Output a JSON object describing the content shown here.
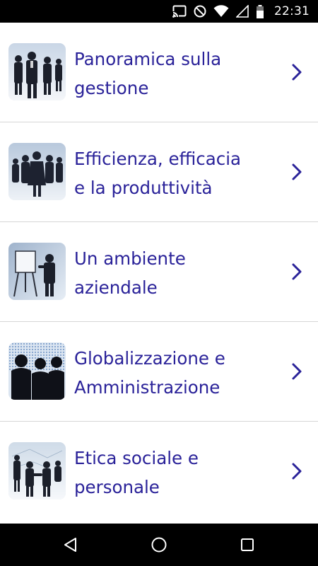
{
  "status_bar": {
    "time": "22:31",
    "icons": [
      "cast-icon",
      "do-not-disturb-icon",
      "wifi-icon",
      "signal-icon",
      "battery-icon"
    ]
  },
  "list": {
    "items": [
      {
        "label": "Panoramica sulla\ngestione",
        "thumb_icon": "business-team-image"
      },
      {
        "label": "Efficienza, efficacia\ne la produttività",
        "thumb_icon": "business-team-image"
      },
      {
        "label": "Un ambiente\naziendale",
        "thumb_icon": "presentation-flipchart-image"
      },
      {
        "label": "Globalizzazione e\nAmministrazione",
        "thumb_icon": "business-silhouettes-image"
      },
      {
        "label": "Etica sociale e\npersonale",
        "thumb_icon": "handshake-image"
      }
    ],
    "chevron_icon": "chevron-right-icon"
  },
  "nav_bar": {
    "buttons": [
      "back-icon",
      "home-icon",
      "recent-apps-icon"
    ]
  },
  "colors": {
    "label": "#2a2299",
    "chevron": "#2a2299",
    "status_bar": "#000000",
    "nav_bar": "#000000",
    "divider": "#d6d6d6"
  }
}
